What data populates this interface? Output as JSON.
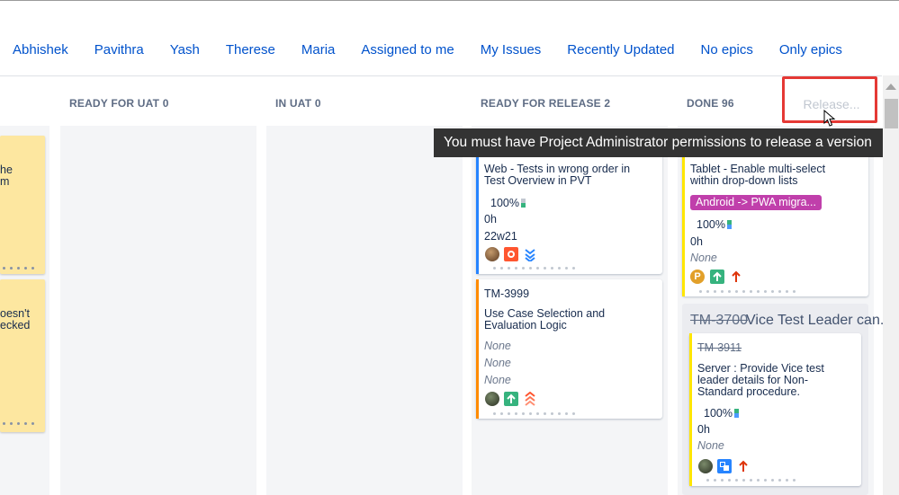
{
  "filters": [
    "Abhishek",
    "Pavithra",
    "Yash",
    "Therese",
    "Maria",
    "Assigned to me",
    "My Issues",
    "Recently Updated",
    "No epics",
    "Only epics"
  ],
  "columns": {
    "ready_for_uat": "READY FOR UAT 0",
    "in_uat": "IN UAT 0",
    "ready_for_release": "READY FOR RELEASE 2",
    "done": "DONE 96"
  },
  "release_button": "Release...",
  "tooltip": "You must have Project Administrator permissions to release a version",
  "stickies": [
    {
      "line1": "he",
      "line2": "m"
    },
    {
      "line1": "oesn't",
      "line2": "ecked"
    }
  ],
  "cards": {
    "web_tests": {
      "title_line1": "Web - Tests in wrong order in",
      "title_line2": "Test Overview in PVT",
      "progress": "100%",
      "estimate": "0h",
      "sprint": "22w21",
      "bar_color": "#2684ff"
    },
    "tm3999": {
      "key": "TM-3999",
      "title_line1": "Use Case Selection and",
      "title_line2": "Evaluation Logic",
      "field1": "None",
      "field2": "None",
      "field3": "None",
      "bar_color": "#ff8b00"
    },
    "tablet": {
      "title_line1": "Tablet - Enable multi-select",
      "title_line2": "within drop-down lists",
      "epic": "Android -> PWA migra...",
      "progress": "100%",
      "estimate": "0h",
      "field": "None",
      "bar_color": "#ffe600"
    },
    "tm3700": {
      "key": "TM-3700",
      "summary": "Vice Test Leader can..."
    },
    "tm3911": {
      "key": "TM-3911",
      "title_line1": "Server : Provide Vice test",
      "title_line2": "leader details for Non-",
      "title_line3": "Standard procedure.",
      "progress": "100%",
      "estimate": "0h",
      "field": "None",
      "bar_color": "#ffe600"
    }
  },
  "icons": {
    "bug": "bug-icon",
    "story": "story-icon",
    "subtask": "subtask-icon",
    "priority_lowest": "priority-lowest-icon",
    "priority_highest": "priority-highest-icon",
    "priority_high": "priority-high-icon"
  }
}
